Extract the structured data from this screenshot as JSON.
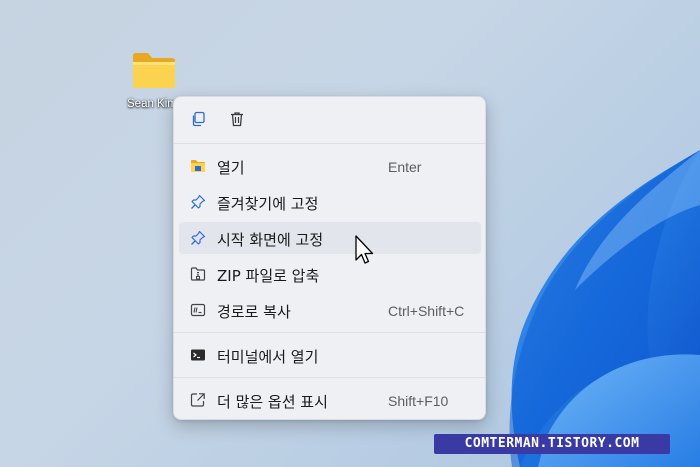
{
  "desktop": {
    "folder_label": "Sean Kim",
    "folder_icon": "folder-icon"
  },
  "context_menu": {
    "toolbar": [
      {
        "name": "copy-icon",
        "action": "copy"
      },
      {
        "name": "delete-icon",
        "action": "delete"
      }
    ],
    "items": [
      {
        "icon": "folder-open-icon",
        "label": "열기",
        "shortcut": "Enter"
      },
      {
        "icon": "pin-icon",
        "label": "즐겨찾기에 고정",
        "shortcut": ""
      },
      {
        "icon": "pin-icon",
        "label": "시작 화면에 고정",
        "shortcut": "",
        "hovered": true
      },
      {
        "icon": "zip-icon",
        "label": "ZIP 파일로 압축",
        "shortcut": ""
      },
      {
        "icon": "copy-path-icon",
        "label": "경로로 복사",
        "shortcut": "Ctrl+Shift+C"
      },
      {
        "icon": "terminal-icon",
        "label": "터미널에서 열기",
        "shortcut": ""
      },
      {
        "icon": "more-options-icon",
        "label": "더 많은 옵션 표시",
        "shortcut": "Shift+F10"
      }
    ]
  },
  "watermark": "COMTERMAN.TISTORY.COM",
  "colors": {
    "menu_bg": "#eef0f4",
    "hover_bg": "#e2e6ec",
    "icon_blue": "#2f6bd8",
    "folder_yellow": "#f7c948",
    "watermark_bg": "#3a3aa4"
  }
}
